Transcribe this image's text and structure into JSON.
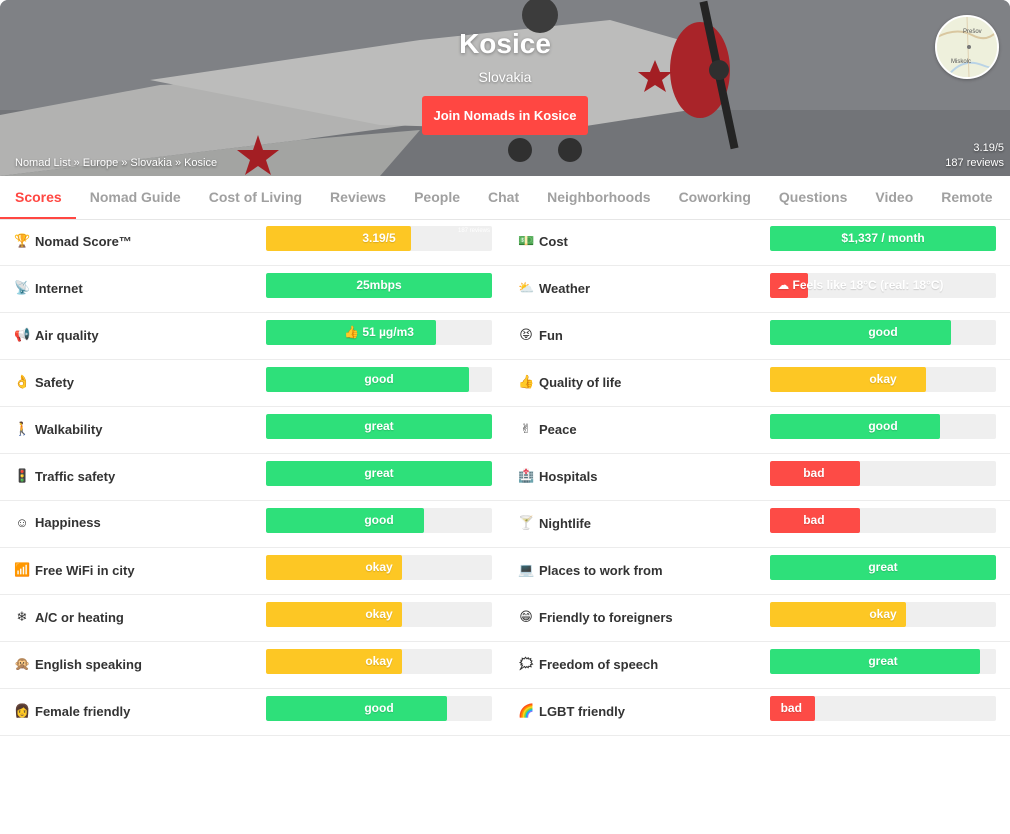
{
  "hero": {
    "city": "Kosice",
    "country": "Slovakia",
    "join_label": "Join Nomads in Kosice",
    "breadcrumb": [
      "Nomad List",
      "»",
      "Europe",
      "»",
      "Slovakia",
      "»",
      "Kosice"
    ],
    "score": "3.19/5",
    "reviews": "187 reviews",
    "map_labels": [
      "Prešov",
      "Miskolc"
    ]
  },
  "tabs": [
    "Scores",
    "Nomad Guide",
    "Cost of Living",
    "Reviews",
    "People",
    "Chat",
    "Neighborhoods",
    "Coworking",
    "Questions",
    "Video",
    "Remote"
  ],
  "active_tab": "Scores",
  "colors": {
    "green": "#2ee07a",
    "yellow": "#fdc724",
    "red": "#fd4b46",
    "accent": "#ff4742"
  },
  "scores": {
    "left": [
      {
        "label": "Nomad Score™",
        "icon": "trophy-icon",
        "emoji": "🏆",
        "value": "3.19/5",
        "level": 0.64,
        "color": "yellow",
        "note": "187 reviews"
      },
      {
        "label": "Internet",
        "icon": "satellite-icon",
        "emoji": "📡",
        "value": "25mbps",
        "level": 1.0,
        "color": "green"
      },
      {
        "label": "Air quality",
        "icon": "loudspeaker-icon",
        "emoji": "📢",
        "value": "👍 51 µg/m3",
        "level": 0.75,
        "color": "green"
      },
      {
        "label": "Safety",
        "icon": "ok-hand-icon",
        "emoji": "👌",
        "value": "good",
        "level": 0.9,
        "color": "green"
      },
      {
        "label": "Walkability",
        "icon": "walking-person-icon",
        "emoji": "🚶",
        "value": "great",
        "level": 1.0,
        "color": "green"
      },
      {
        "label": "Traffic safety",
        "icon": "traffic-light-icon",
        "emoji": "🚦",
        "value": "great",
        "level": 1.0,
        "color": "green"
      },
      {
        "label": "Happiness",
        "icon": "smile-icon",
        "emoji": "☺",
        "value": "good",
        "level": 0.7,
        "color": "green"
      },
      {
        "label": "Free WiFi in city",
        "icon": "signal-bars-icon",
        "emoji": "📶",
        "value": "okay",
        "level": 0.6,
        "color": "yellow"
      },
      {
        "label": "A/C or heating",
        "icon": "snowflake-icon",
        "emoji": "❄",
        "value": "okay",
        "level": 0.6,
        "color": "yellow"
      },
      {
        "label": "English speaking",
        "icon": "monkey-icon",
        "emoji": "🙊",
        "value": "okay",
        "level": 0.6,
        "color": "yellow"
      },
      {
        "label": "Female friendly",
        "icon": "woman-icon",
        "emoji": "👩",
        "value": "good",
        "level": 0.8,
        "color": "green"
      }
    ],
    "right": [
      {
        "label": "Cost",
        "icon": "money-icon",
        "emoji": "💵",
        "value": "$1,337 / month",
        "level": 1.0,
        "color": "green"
      },
      {
        "label": "Weather",
        "icon": "sun-cloud-icon",
        "emoji": "⛅",
        "value": "☁ Feels like 18°C (real: 18°C)",
        "level": 0.17,
        "color": "red"
      },
      {
        "label": "Fun",
        "icon": "grinning-face-icon",
        "emoji": "😝",
        "value": "good",
        "level": 0.8,
        "color": "green"
      },
      {
        "label": "Quality of life",
        "icon": "thumbs-up-icon",
        "emoji": "👍",
        "value": "okay",
        "level": 0.69,
        "color": "yellow"
      },
      {
        "label": "Peace",
        "icon": "peace-hand-icon",
        "emoji": "✌",
        "value": "good",
        "level": 0.75,
        "color": "green"
      },
      {
        "label": "Hospitals",
        "icon": "hospital-icon",
        "emoji": "🏥",
        "value": "bad",
        "level": 0.4,
        "color": "red"
      },
      {
        "label": "Nightlife",
        "icon": "cocktail-icon",
        "emoji": "🍸",
        "value": "bad",
        "level": 0.4,
        "color": "red"
      },
      {
        "label": "Places to work from",
        "icon": "laptop-icon",
        "emoji": "💻",
        "value": "great",
        "level": 1.0,
        "color": "green"
      },
      {
        "label": "Friendly to foreigners",
        "icon": "smiling-face-icon",
        "emoji": "😁",
        "value": "okay",
        "level": 0.6,
        "color": "yellow"
      },
      {
        "label": "Freedom of speech",
        "icon": "speech-icon",
        "emoji": "🗯",
        "value": "great",
        "level": 0.93,
        "color": "green"
      },
      {
        "label": "LGBT friendly",
        "icon": "rainbow-icon",
        "emoji": "🌈",
        "value": "bad",
        "level": 0.2,
        "color": "red"
      }
    ]
  }
}
